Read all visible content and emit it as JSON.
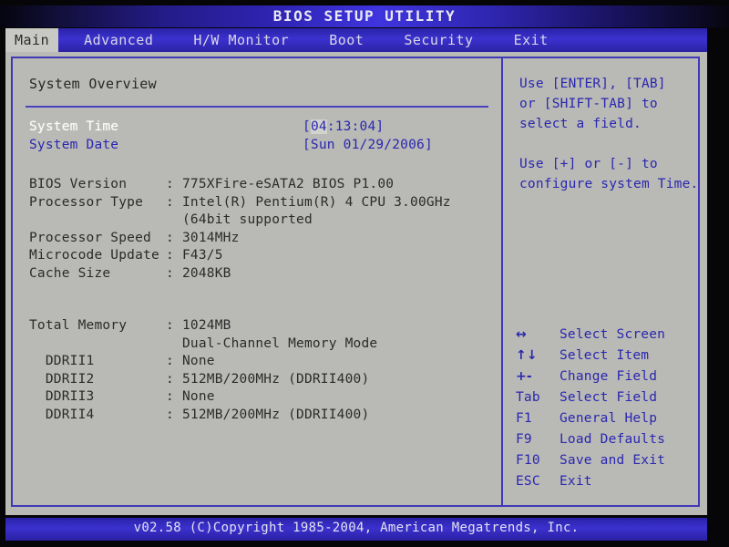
{
  "window": {
    "title": "BIOS SETUP UTILITY"
  },
  "menubar": {
    "items": [
      {
        "label": "Main",
        "active": true
      },
      {
        "label": "Advanced",
        "active": false
      },
      {
        "label": "H/W Monitor",
        "active": false
      },
      {
        "label": "Boot",
        "active": false
      },
      {
        "label": "Security",
        "active": false
      },
      {
        "label": "Exit",
        "active": false
      }
    ]
  },
  "main": {
    "section_title": "System Overview",
    "time_field": {
      "label": "System Time",
      "selected": true,
      "open_bracket": "[",
      "cursor_segment": "04",
      "rest": ":13:04",
      "close_bracket": "]"
    },
    "date_field": {
      "label": "System Date",
      "selected": false,
      "value": "[Sun 01/29/2006]"
    },
    "info_rows": [
      {
        "label": "BIOS Version",
        "sep": ":",
        "value": "775XFire-eSATA2 BIOS P1.00"
      },
      {
        "label": "Processor Type",
        "sep": ":",
        "value": "Intel(R) Pentium(R) 4 CPU 3.00GHz"
      },
      {
        "label": "",
        "sep": "",
        "value": "(64bit supported"
      },
      {
        "label": "Processor Speed",
        "sep": ":",
        "value": "3014MHz"
      },
      {
        "label": "Microcode Update",
        "sep": ":",
        "value": "F43/5"
      },
      {
        "label": "Cache Size",
        "sep": ":",
        "value": "2048KB"
      }
    ],
    "memory_rows": [
      {
        "label": "Total Memory",
        "sep": ":",
        "value": "1024MB"
      },
      {
        "label": "",
        "sep": "",
        "value": "Dual-Channel Memory Mode"
      },
      {
        "label": "  DDRII1",
        "sep": ":",
        "value": "None"
      },
      {
        "label": "  DDRII2",
        "sep": ":",
        "value": "512MB/200MHz (DDRII400)"
      },
      {
        "label": "  DDRII3",
        "sep": ":",
        "value": "None"
      },
      {
        "label": "  DDRII4",
        "sep": ":",
        "value": "512MB/200MHz (DDRII400)"
      }
    ]
  },
  "help": {
    "lines": [
      "Use [ENTER], [TAB]",
      "or [SHIFT-TAB] to",
      "select a field.",
      "",
      "Use [+] or [-] to",
      "configure system Time."
    ],
    "keys": [
      {
        "key": "↔",
        "icon": "left-right-arrow-icon",
        "action": "Select Screen"
      },
      {
        "key": "↑↓",
        "icon": "up-down-arrow-icon",
        "action": "Select Item"
      },
      {
        "key": "+-",
        "icon": "plus-minus-icon",
        "action": "Change Field"
      },
      {
        "key": "Tab",
        "icon": "tab-key-icon",
        "action": "Select Field"
      },
      {
        "key": "F1",
        "icon": "f1-key-icon",
        "action": "General Help"
      },
      {
        "key": "F9",
        "icon": "f9-key-icon",
        "action": "Load Defaults"
      },
      {
        "key": "F10",
        "icon": "f10-key-icon",
        "action": "Save and Exit"
      },
      {
        "key": "ESC",
        "icon": "esc-key-icon",
        "action": "Exit"
      }
    ]
  },
  "footer": {
    "text": "v02.58 (C)Copyright 1985-2004, American Megatrends, Inc."
  },
  "colors": {
    "accent_blue": "#2a27b0",
    "panel_bg": "#b9b9b5",
    "bar_blue": "#3b31cf",
    "selected_text": "#fbfbfb",
    "cursor_highlight": "#d3d3ce"
  }
}
